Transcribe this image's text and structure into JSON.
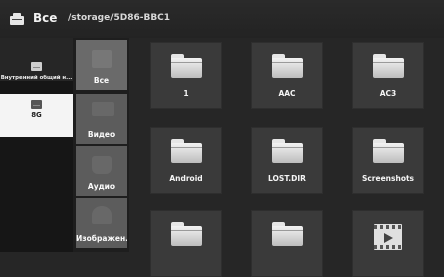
{
  "header": {
    "title": "Все",
    "path": "/storage/5D86-BBC1",
    "icon": "storage-device-icon"
  },
  "devices": [
    {
      "label": "Внутренний общий н...",
      "icon": "internal-storage-icon"
    },
    {
      "label": "8G",
      "icon": "sd-card-icon",
      "selected": true
    }
  ],
  "categories": [
    {
      "label": "Все",
      "icon": "all-files-icon"
    },
    {
      "label": "Видео",
      "icon": "video-icon"
    },
    {
      "label": "Аудио",
      "icon": "audio-icon"
    },
    {
      "label": "Изображен...",
      "icon": "image-icon"
    }
  ],
  "folders": [
    {
      "name": "1",
      "icon": "folder-icon"
    },
    {
      "name": "AAC",
      "icon": "folder-icon"
    },
    {
      "name": "AC3",
      "icon": "folder-icon"
    },
    {
      "name": "Android",
      "icon": "folder-icon"
    },
    {
      "name": "LOST.DIR",
      "icon": "folder-icon"
    },
    {
      "name": "Screenshots",
      "icon": "folder-icon"
    },
    {
      "name": "",
      "icon": "folder-icon"
    },
    {
      "name": "",
      "icon": "folder-icon"
    },
    {
      "name": "",
      "icon": "video-file-icon"
    }
  ],
  "colors": {
    "background": "#262626",
    "tile": "#3a3a3a",
    "selected_device": "#f4f4f4"
  }
}
